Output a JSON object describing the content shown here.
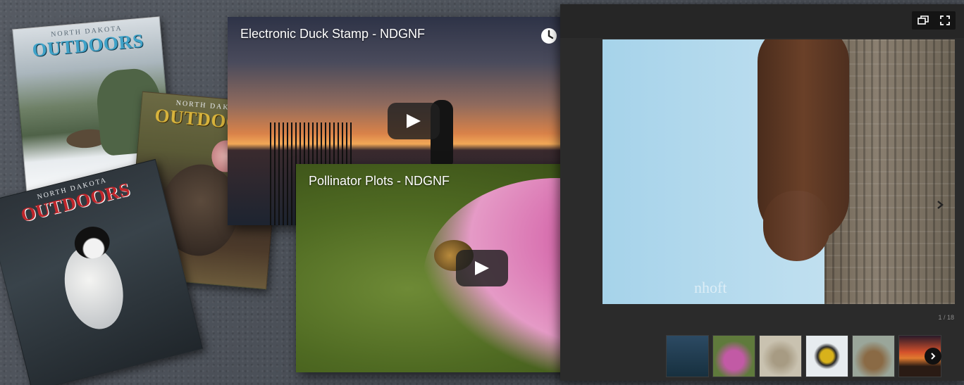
{
  "magazines": [
    {
      "id": "winter",
      "masthead_top": "NORTH DAKOTA",
      "masthead": "OUTDOORS"
    },
    {
      "id": "turkey",
      "masthead_top": "NORTH DAKOTA",
      "masthead": "OUTDOORS"
    },
    {
      "id": "chickadee",
      "masthead_top": "NORTH DAKOTA",
      "masthead": "OUTDOORS"
    }
  ],
  "videos": [
    {
      "title": "Electronic Duck Stamp - NDGNF",
      "watch_later_icon": "clock-icon",
      "share_icon": "share-arrow-icon",
      "play_icon": "play-icon"
    },
    {
      "title": "Pollinator Plots - NDGNF",
      "watch_later_icon": "clock-icon",
      "share_icon": "share-arrow-icon",
      "play_icon": "play-icon"
    }
  ],
  "gallery": {
    "counter": "1 / 18",
    "watermark": "nhoft",
    "thumbnail_count": 6,
    "thumbnails": [
      "water",
      "thistle",
      "grouse",
      "grosbeak",
      "elk",
      "sunset"
    ]
  },
  "colors": {
    "gallery_bg": "#2b2b2b",
    "youtube_play_bg": "#212121",
    "masthead_blue": "#3fa2c8",
    "masthead_gold": "#d7b33c",
    "masthead_red": "#c0262b"
  }
}
